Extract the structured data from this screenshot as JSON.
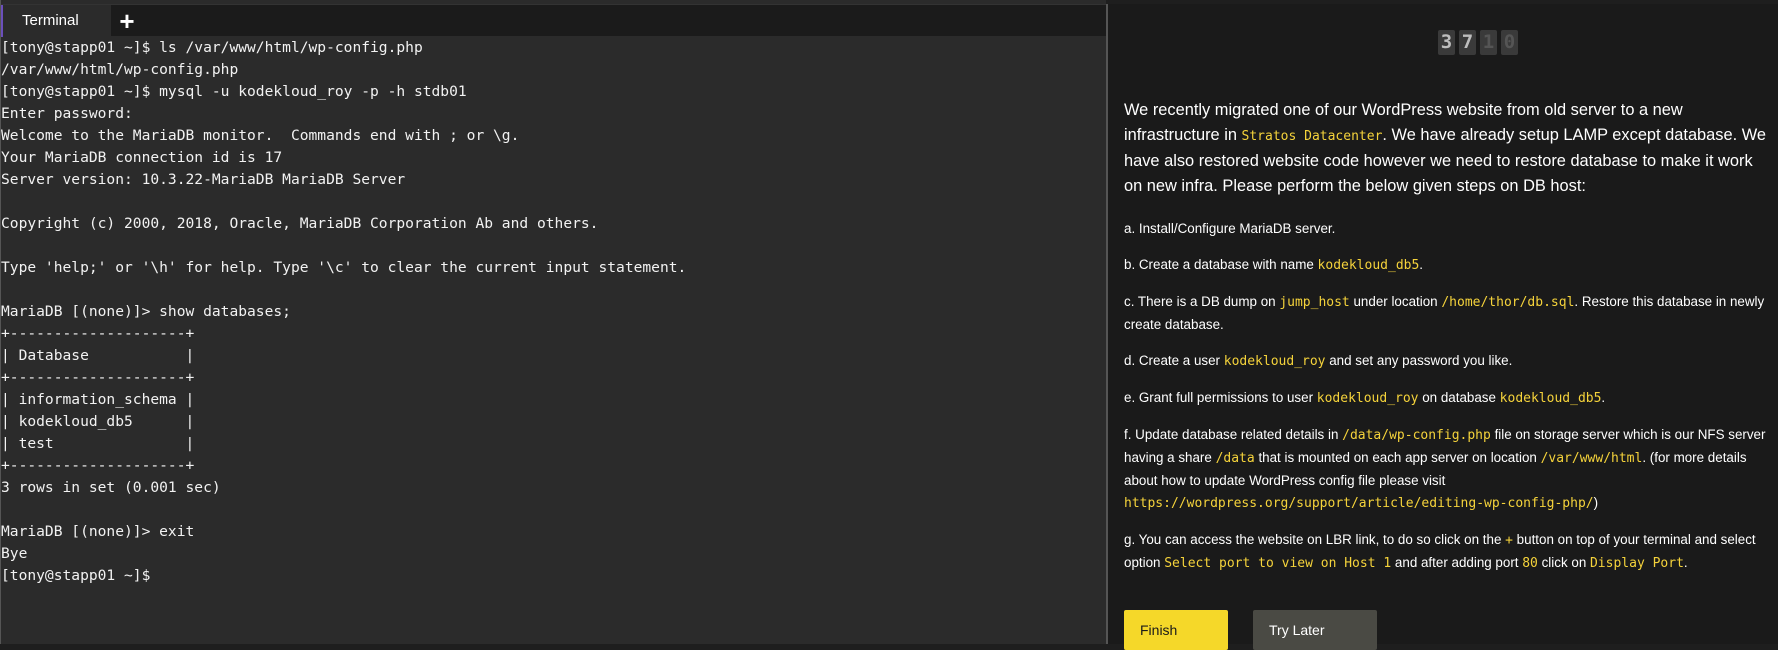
{
  "terminal": {
    "tab_label": "Terminal",
    "new_tab_label": "+",
    "lines": [
      "[tony@stapp01 ~]$ ls /var/www/html/wp-config.php",
      "/var/www/html/wp-config.php",
      "[tony@stapp01 ~]$ mysql -u kodekloud_roy -p -h stdb01",
      "Enter password:",
      "Welcome to the MariaDB monitor.  Commands end with ; or \\g.",
      "Your MariaDB connection id is 17",
      "Server version: 10.3.22-MariaDB MariaDB Server",
      "",
      "Copyright (c) 2000, 2018, Oracle, MariaDB Corporation Ab and others.",
      "",
      "Type 'help;' or '\\h' for help. Type '\\c' to clear the current input statement.",
      "",
      "MariaDB [(none)]> show databases;",
      "+--------------------+",
      "| Database           |",
      "+--------------------+",
      "| information_schema |",
      "| kodekloud_db5      |",
      "| test               |",
      "+--------------------+",
      "3 rows in set (0.001 sec)",
      "",
      "MariaDB [(none)]> exit",
      "Bye",
      "[tony@stapp01 ~]$"
    ]
  },
  "timer": {
    "d1": "3",
    "d2": "7",
    "d3": "1",
    "d4": "0"
  },
  "task": {
    "intro": {
      "t1": "We recently migrated one of our WordPress website from old server to a new infrastructure in ",
      "c1": "Stratos Datacenter",
      "t2": ". We have already setup LAMP except database. We have also restored website code however we need to restore database to make it work on new infra. Please perform the below given steps on DB host:"
    },
    "step_a": {
      "t1": "a. Install/Configure MariaDB server."
    },
    "step_b": {
      "t1": "b. Create a database with name ",
      "c1": "kodekloud_db5",
      "t2": "."
    },
    "step_c": {
      "t1": "c. There is a DB dump on ",
      "c1": "jump_host",
      "t2": " under location ",
      "c2": "/home/thor/db.sql",
      "t3": ". Restore this database in newly create database."
    },
    "step_d": {
      "t1": "d. Create a user ",
      "c1": "kodekloud_roy",
      "t2": " and set any password you like."
    },
    "step_e": {
      "t1": "e. Grant full permissions to user ",
      "c1": "kodekloud_roy",
      "t2": " on database ",
      "c2": "kodekloud_db5",
      "t3": "."
    },
    "step_f": {
      "t1": "f. Update database related details in ",
      "c1": "/data/wp-config.php",
      "t2": " file on storage server which is our NFS server having a share ",
      "c2": "/data",
      "t3": " that is mounted on each app server on location ",
      "c3": "/var/www/html",
      "t4": ". (for more details about how to update WordPress config file please visit ",
      "c4": "https://wordpress.org/support/article/editing-wp-config-php/",
      "t5": ")"
    },
    "step_g": {
      "t1": "g. You can access the website on LBR link, to do so click on the ",
      "c1": "+",
      "t2": " button on top of your terminal and select option ",
      "c2": "Select port to view on Host 1",
      "t3": " and after adding port ",
      "c3": "80",
      "t4": " click on ",
      "c4": "Display Port",
      "t5": "."
    }
  },
  "buttons": {
    "finish": "Finish",
    "try_later": "Try Later"
  },
  "colors": {
    "code_highlight": "#f5d33b",
    "finish_bg": "#f5d829",
    "terminal_bg": "#2b2b2b"
  }
}
